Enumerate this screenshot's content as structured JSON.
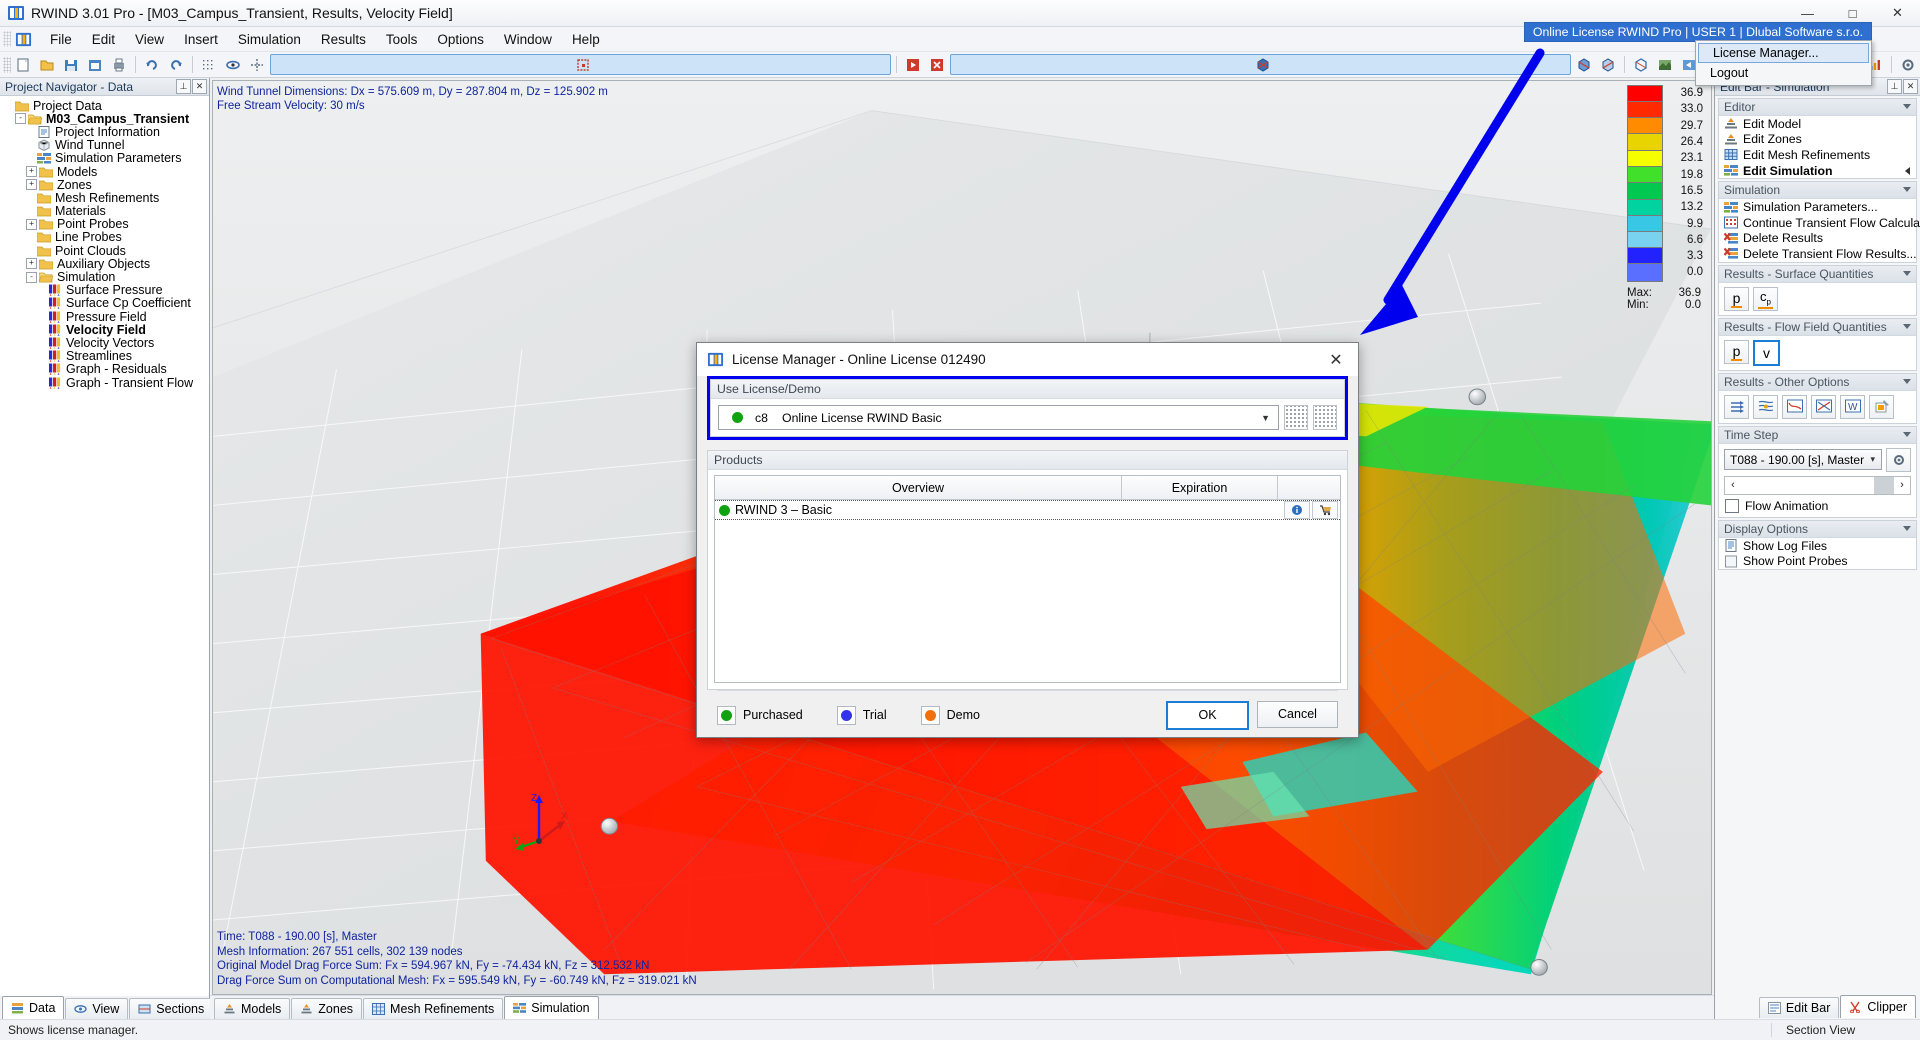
{
  "window": {
    "title": "RWIND 3.01 Pro - [M03_Campus_Transient, Results, Velocity Field]",
    "app_icon": "rwind-icon",
    "minimize": "—",
    "maximize": "□",
    "close": "✕"
  },
  "menubar": {
    "items": [
      "File",
      "Edit",
      "View",
      "Insert",
      "Simulation",
      "Results",
      "Tools",
      "Options",
      "Window",
      "Help"
    ]
  },
  "license_badge": {
    "text": "Online License RWIND Pro | USER 1 | Dlubal Software s.r.o.",
    "color": "#2f6fd0"
  },
  "license_menu": {
    "items": [
      {
        "label": "License Manager...",
        "highlighted": true
      },
      {
        "label": "Logout",
        "highlighted": false
      }
    ]
  },
  "left_panel": {
    "caption": "Project Navigator - Data",
    "pin": "⊥",
    "close": "✕",
    "tree": [
      {
        "label": "Project Data",
        "depth": 0,
        "expander": "",
        "icon": "folder-icon",
        "bold": false
      },
      {
        "label": "M03_Campus_Transient",
        "depth": 1,
        "expander": "-",
        "icon": "folder-open-icon",
        "bold": true
      },
      {
        "label": "Project Information",
        "depth": 2,
        "expander": "",
        "icon": "document-icon",
        "bold": false
      },
      {
        "label": "Wind Tunnel",
        "depth": 2,
        "expander": "",
        "icon": "cube-icon",
        "bold": false
      },
      {
        "label": "Simulation Parameters",
        "depth": 2,
        "expander": "",
        "icon": "sim-params-icon",
        "bold": false
      },
      {
        "label": "Models",
        "depth": 2,
        "expander": "+",
        "icon": "folder-icon",
        "bold": false
      },
      {
        "label": "Zones",
        "depth": 2,
        "expander": "+",
        "icon": "folder-icon",
        "bold": false
      },
      {
        "label": "Mesh Refinements",
        "depth": 2,
        "expander": "",
        "icon": "folder-icon",
        "bold": false
      },
      {
        "label": "Materials",
        "depth": 2,
        "expander": "",
        "icon": "folder-icon",
        "bold": false
      },
      {
        "label": "Point Probes",
        "depth": 2,
        "expander": "+",
        "icon": "folder-icon",
        "bold": false
      },
      {
        "label": "Line Probes",
        "depth": 2,
        "expander": "",
        "icon": "folder-icon",
        "bold": false
      },
      {
        "label": "Point Clouds",
        "depth": 2,
        "expander": "",
        "icon": "folder-icon",
        "bold": false
      },
      {
        "label": "Auxiliary Objects",
        "depth": 2,
        "expander": "+",
        "icon": "folder-icon",
        "bold": false
      },
      {
        "label": "Simulation",
        "depth": 2,
        "expander": "-",
        "icon": "folder-open-icon",
        "bold": false
      },
      {
        "label": "Surface Pressure",
        "depth": 3,
        "expander": "",
        "icon": "result-icon",
        "bold": false
      },
      {
        "label": "Surface Cp Coefficient",
        "depth": 3,
        "expander": "",
        "icon": "result-icon",
        "bold": false
      },
      {
        "label": "Pressure Field",
        "depth": 3,
        "expander": "",
        "icon": "result-icon",
        "bold": false
      },
      {
        "label": "Velocity Field",
        "depth": 3,
        "expander": "",
        "icon": "result-icon",
        "bold": true
      },
      {
        "label": "Velocity Vectors",
        "depth": 3,
        "expander": "",
        "icon": "result-icon",
        "bold": false
      },
      {
        "label": "Streamlines",
        "depth": 3,
        "expander": "",
        "icon": "result-icon",
        "bold": false
      },
      {
        "label": "Graph - Residuals",
        "depth": 3,
        "expander": "",
        "icon": "result-icon",
        "bold": false
      },
      {
        "label": "Graph - Transient Flow",
        "depth": 3,
        "expander": "",
        "icon": "result-icon",
        "bold": false
      }
    ],
    "tabs": [
      {
        "label": "Data",
        "icon": "data-icon",
        "active": true
      },
      {
        "label": "View",
        "icon": "view-icon",
        "active": false
      },
      {
        "label": "Sections",
        "icon": "sections-icon",
        "active": false
      }
    ]
  },
  "viewport": {
    "overlay_top_line1": "Wind Tunnel Dimensions: Dx = 575.609 m, Dy = 287.804 m, Dz = 125.902 m",
    "overlay_top_line2": "Free Stream Velocity: 30 m/s",
    "overlay_bottom": [
      "Time: T088 - 190.00 [s], Master",
      "Mesh Information: 267 551 cells, 302 139 nodes",
      "Original Model Drag Force Sum: Fx = 594.967 kN, Fy = -74.434 kN, Fz = 312.532 kN",
      "Drag Force Sum on Computational Mesh: Fx = 595.549 kN, Fy = -60.749 kN, Fz = 319.021 kN"
    ],
    "axis": {
      "x": "X",
      "y": "Y",
      "z": "Z"
    },
    "legend": {
      "entries": [
        {
          "value": "36.9",
          "color": "#ff0000"
        },
        {
          "value": "33.0",
          "color": "#ff2a00"
        },
        {
          "value": "29.7",
          "color": "#ff8c00"
        },
        {
          "value": "26.4",
          "color": "#e8d400"
        },
        {
          "value": "23.1",
          "color": "#f6ff00"
        },
        {
          "value": "19.8",
          "color": "#41e02a"
        },
        {
          "value": "16.5",
          "color": "#00c850"
        },
        {
          "value": "13.2",
          "color": "#00d2a0"
        },
        {
          "value": "9.9",
          "color": "#38c8e6"
        },
        {
          "value": "6.6",
          "color": "#78d2f0"
        },
        {
          "value": "3.3",
          "color": "#2222ff"
        },
        {
          "value": "0.0",
          "color": "#5a6eff"
        }
      ],
      "max_label": "Max:",
      "max_value": "36.9",
      "min_label": "Min:",
      "min_value": "0.0"
    }
  },
  "right_panel": {
    "caption": "Edit Bar - Simulation",
    "pin": "⊥",
    "close": "✕",
    "groups": [
      {
        "title": "Editor",
        "type": "items",
        "items": [
          {
            "label": "Edit Model",
            "icon": "edit-model-icon",
            "bold": false,
            "caret": false
          },
          {
            "label": "Edit Zones",
            "icon": "edit-zones-icon",
            "bold": false,
            "caret": false
          },
          {
            "label": "Edit Mesh Refinements",
            "icon": "mesh-icon",
            "bold": false,
            "caret": false
          },
          {
            "label": "Edit Simulation",
            "icon": "sim-icon",
            "bold": true,
            "caret": true
          }
        ]
      },
      {
        "title": "Simulation",
        "type": "items",
        "items": [
          {
            "label": "Simulation Parameters...",
            "icon": "params-icon",
            "bold": false,
            "caret": false
          },
          {
            "label": "Continue Transient Flow Calculat...",
            "icon": "continue-icon",
            "bold": false,
            "caret": false
          },
          {
            "label": "Delete Results",
            "icon": "delete-results-icon",
            "bold": false,
            "caret": false
          },
          {
            "label": "Delete Transient Flow Results...",
            "icon": "delete-transient-icon",
            "bold": false,
            "caret": false
          }
        ]
      },
      {
        "title": "Results - Surface Quantities",
        "type": "buttons",
        "buttons": [
          {
            "label": "p",
            "name": "surface-pressure-button",
            "active": false
          },
          {
            "label": "cp",
            "name": "surface-cp-button",
            "active": false
          }
        ]
      },
      {
        "title": "Results - Flow Field Quantities",
        "type": "buttons",
        "buttons": [
          {
            "label": "p",
            "name": "pressure-field-button",
            "active": false
          },
          {
            "label": "v",
            "name": "velocity-field-button",
            "active": true
          }
        ]
      },
      {
        "title": "Results - Other Options",
        "type": "buttons",
        "buttons": [
          {
            "label": "⇉",
            "name": "velocity-vectors-button",
            "active": false
          },
          {
            "label": "≋",
            "name": "streamlines-button",
            "active": false
          },
          {
            "label": "∿",
            "name": "graph-residuals-button",
            "active": false
          },
          {
            "label": "◪",
            "name": "graph-transient-button",
            "active": false
          },
          {
            "label": "W",
            "name": "wind-report-button",
            "active": false
          },
          {
            "label": "⬓",
            "name": "result-settings-button",
            "active": false
          }
        ]
      }
    ],
    "time_step": {
      "title": "Time Step",
      "selected": "T088 - 190.00 [s], Master",
      "settings_icon": "gear-icon",
      "prev": "‹",
      "next": "›",
      "flow_animation_label": "Flow Animation",
      "flow_animation_checked": false
    },
    "display_options": {
      "title": "Display Options",
      "items": [
        {
          "label": "Show Log Files",
          "icon": "log-file-icon"
        },
        {
          "label": "Show Point Probes",
          "icon": "point-probe-icon"
        }
      ]
    }
  },
  "bottom_tabs": [
    {
      "label": "Models",
      "icon": "models-icon",
      "active": false
    },
    {
      "label": "Zones",
      "icon": "zones-icon",
      "active": false
    },
    {
      "label": "Mesh Refinements",
      "icon": "mesh-refinements-icon",
      "active": false
    },
    {
      "label": "Simulation",
      "icon": "simulation-icon",
      "active": true
    }
  ],
  "bottom_right_tabs": [
    {
      "label": "Edit Bar",
      "icon": "edit-bar-icon",
      "active": false
    },
    {
      "label": "Clipper",
      "icon": "clipper-icon",
      "active": true
    }
  ],
  "statusbar": {
    "message": "Shows license manager.",
    "section_view": "Section View"
  },
  "dialog": {
    "title": "License Manager - Online License 012490",
    "icon": "rwind-icon",
    "close": "✕",
    "use_license_group": {
      "title": "Use License/Demo",
      "highlight_color": "#0000ee",
      "selected": {
        "status_color": "#11a211",
        "code": "c8",
        "name": "Online License RWIND Basic"
      },
      "arrow": "▼"
    },
    "products_group": {
      "title": "Products",
      "columns": [
        "Overview",
        "Expiration"
      ],
      "rows": [
        {
          "status_color": "#11a211",
          "name": "RWIND 3 – Basic",
          "expiration": "",
          "actions": [
            {
              "name": "info-icon",
              "glyph": "i"
            },
            {
              "name": "cart-icon",
              "glyph": "🛒"
            }
          ]
        }
      ]
    },
    "legend": [
      {
        "label": "Purchased",
        "color": "#11a211"
      },
      {
        "label": "Trial",
        "color": "#3333ee"
      },
      {
        "label": "Demo",
        "color": "#f07010"
      }
    ],
    "buttons": [
      {
        "label": "OK",
        "name": "ok-button",
        "default": true
      },
      {
        "label": "Cancel",
        "name": "cancel-button",
        "default": false
      }
    ]
  },
  "annotation": {
    "arrow_color": "#0000ee"
  }
}
